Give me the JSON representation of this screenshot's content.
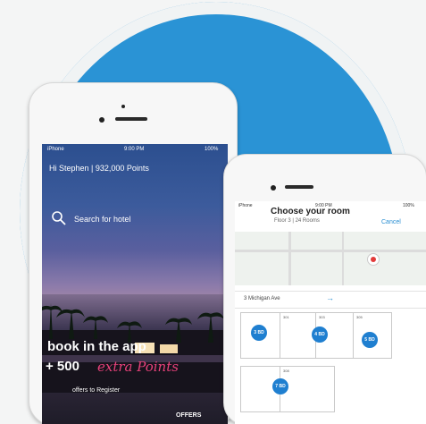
{
  "colors": {
    "circle": "#2a93d5",
    "accent": "#e7417a",
    "link": "#2a8fd2",
    "dot": "#1f7fd0"
  },
  "phone1": {
    "status": {
      "carrier": "iPhone",
      "time": "9:00 PM",
      "battery": "100%"
    },
    "greeting": "Hi Stephen | 932,000 Points",
    "search_label": "Search for hotel",
    "search_icon": "search-icon",
    "cta_line1": "book in the app",
    "cta_line2": "+ 500",
    "cta_script": "extra Points",
    "cta_sub": "offers to Register",
    "offers_tab": "OFFERS"
  },
  "phone2": {
    "status": {
      "carrier": "iPhone",
      "time": "9:00 PM",
      "battery": "100%"
    },
    "title": "Choose your room",
    "subtitle": "Floor 3 | 24 Rooms",
    "cancel": "Cancel",
    "address": "3 Michigan Ave",
    "arrow": "→",
    "rooms": [
      {
        "label": "301",
        "marker": "3 BD"
      },
      {
        "label": "303",
        "marker": "4 BD"
      },
      {
        "label": "305",
        "marker": "5 BD"
      },
      {
        "label": "308",
        "marker": "7 BD"
      }
    ]
  }
}
